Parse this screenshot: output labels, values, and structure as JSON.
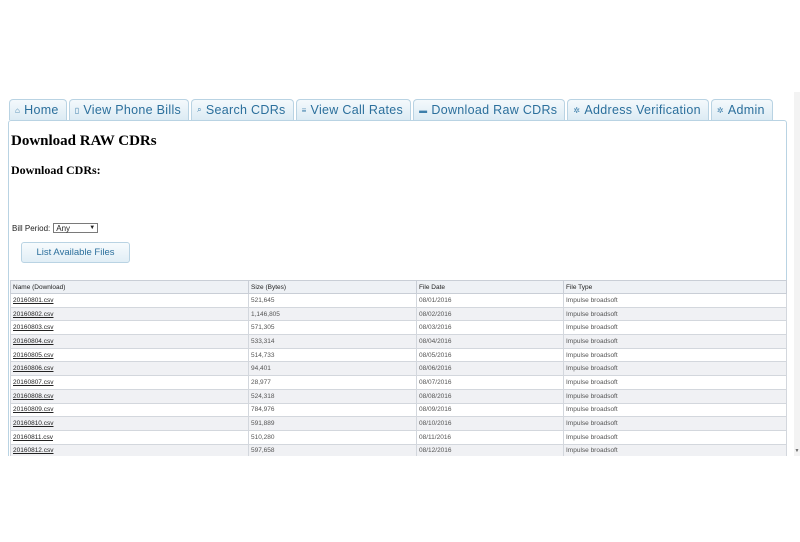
{
  "nav": {
    "tabs": [
      {
        "label": "Home",
        "icon": "home-icon"
      },
      {
        "label": "View Phone Bills",
        "icon": "document-icon"
      },
      {
        "label": "Search CDRs",
        "icon": "search-icon"
      },
      {
        "label": "View Call Rates",
        "icon": "list-icon"
      },
      {
        "label": "Download Raw CDRs",
        "icon": "folder-icon"
      },
      {
        "label": "Address Verification",
        "icon": "gear-icon"
      },
      {
        "label": "Admin",
        "icon": "gear-icon"
      }
    ]
  },
  "page": {
    "title": "Download RAW CDRs",
    "subtitle": "Download CDRs:",
    "bill_period_label": "Bill Period:",
    "bill_period_value": "Any",
    "list_button": "List Available Files"
  },
  "table": {
    "headers": [
      "Name (Download)",
      "Size (Bytes)",
      "File Date",
      "File Type"
    ],
    "rows": [
      [
        "20160801.csv",
        "521,645",
        "08/01/2016",
        "Impulse broadsoft"
      ],
      [
        "20160802.csv",
        "1,146,805",
        "08/02/2016",
        "Impulse broadsoft"
      ],
      [
        "20160803.csv",
        "571,305",
        "08/03/2016",
        "Impulse broadsoft"
      ],
      [
        "20160804.csv",
        "533,314",
        "08/04/2016",
        "Impulse broadsoft"
      ],
      [
        "20160805.csv",
        "514,733",
        "08/05/2016",
        "Impulse broadsoft"
      ],
      [
        "20160806.csv",
        "94,401",
        "08/06/2016",
        "Impulse broadsoft"
      ],
      [
        "20160807.csv",
        "28,977",
        "08/07/2016",
        "Impulse broadsoft"
      ],
      [
        "20160808.csv",
        "524,318",
        "08/08/2016",
        "Impulse broadsoft"
      ],
      [
        "20160809.csv",
        "784,976",
        "08/09/2016",
        "Impulse broadsoft"
      ],
      [
        "20160810.csv",
        "591,889",
        "08/10/2016",
        "Impulse broadsoft"
      ],
      [
        "20160811.csv",
        "510,280",
        "08/11/2016",
        "Impulse broadsoft"
      ],
      [
        "20160812.csv",
        "597,658",
        "08/12/2016",
        "Impulse broadsoft"
      ]
    ]
  }
}
